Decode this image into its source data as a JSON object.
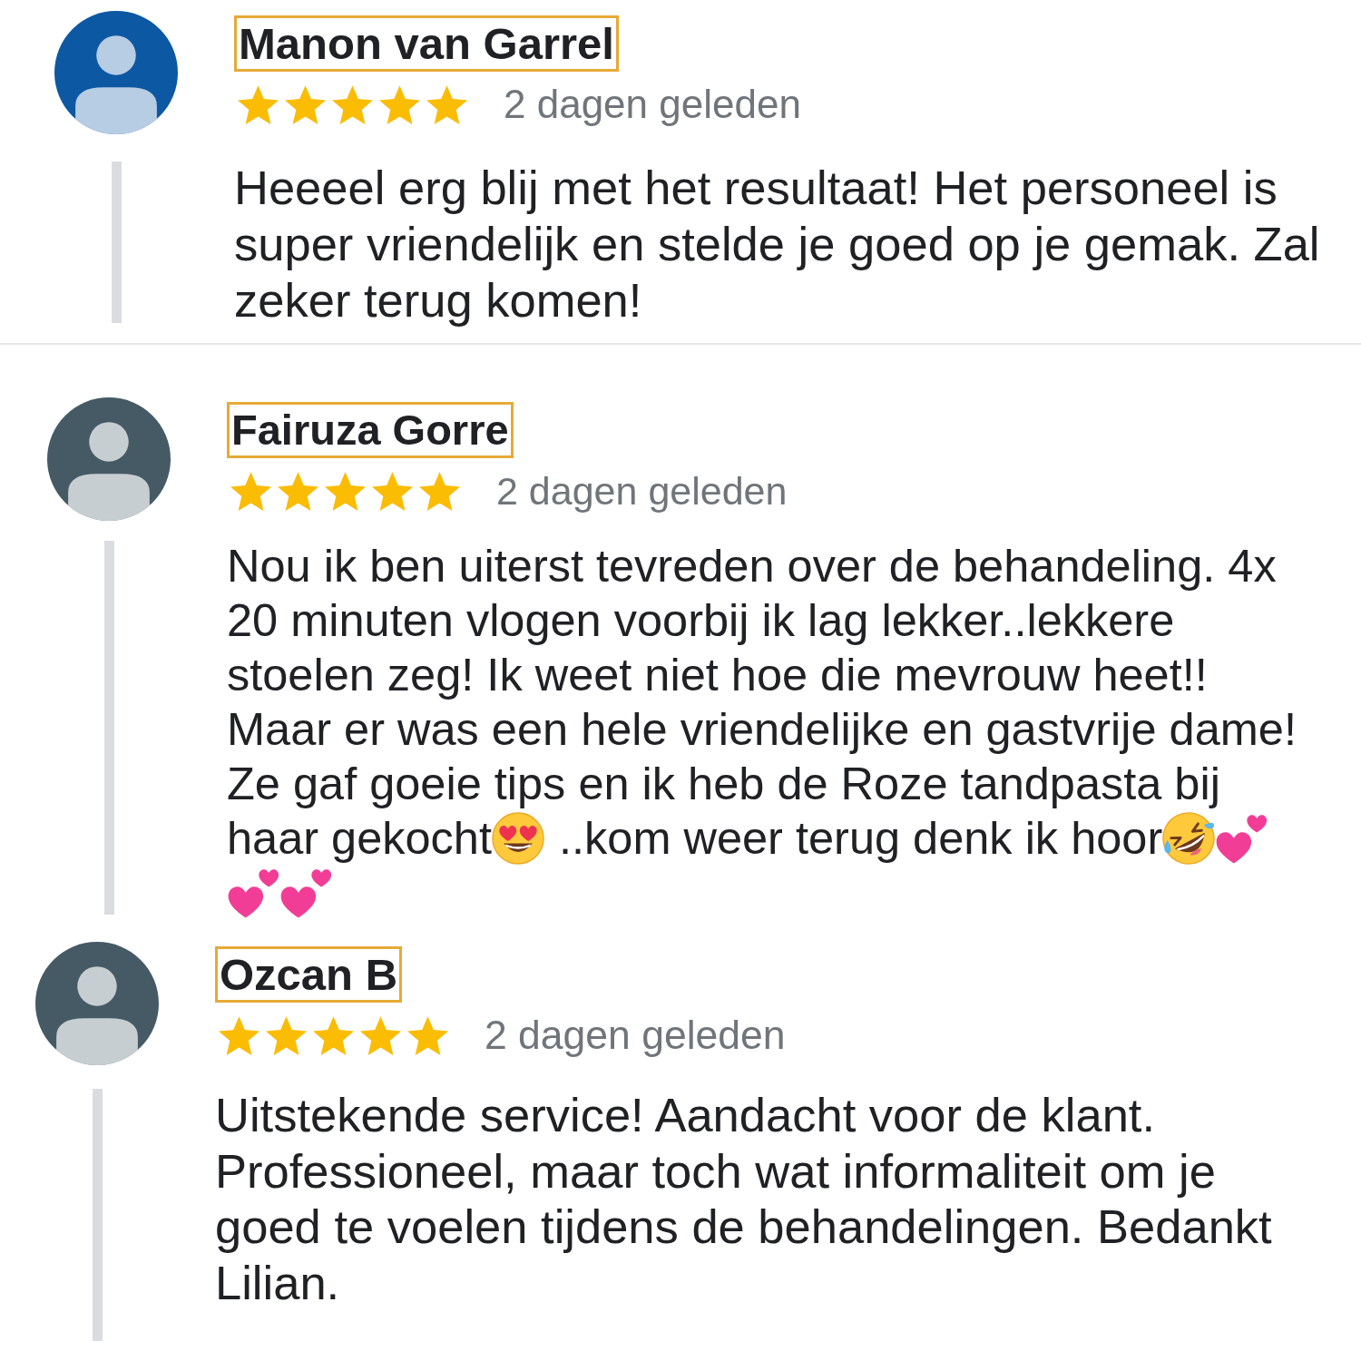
{
  "reviews": [
    {
      "avatar": {
        "color": "#0d58a3"
      },
      "author": {
        "name": "Manon van Garrel",
        "highlighted": true
      },
      "stars": 5,
      "time": "2 dagen geleden",
      "body": [
        {
          "kind": "block",
          "text": "Heeeel erg blij met het resultaat! Het personeel is super vriendelijk en stelde je goed op je gemak. Zal zeker terug komen!"
        }
      ]
    },
    {
      "avatar": {
        "color": "#455a64"
      },
      "author": {
        "name": "Fairuza Gorre",
        "highlighted": true
      },
      "stars": 5,
      "time": "2 dagen geleden",
      "body": [
        {
          "kind": "block",
          "text": "Nou ik ben uiterst tevreden over de behandeling. 4x 20 minuten vlogen voorbij ik lag lekker..lekkere stoelen zeg! Ik weet niet hoe die mevrouw heet!! Maar er was een hele vriendelijke en gastvrije dame! Ze gaf goeie tips en ik heb de Roze tandpasta bij"
        },
        {
          "kind": "text",
          "text": "haar gekocht"
        },
        {
          "kind": "hearteyes"
        },
        {
          "kind": "text",
          "text": "..kom weer terug denk ik hoor"
        },
        {
          "kind": "rofl"
        },
        {
          "kind": "hearts"
        },
        {
          "kind": "hearts"
        },
        {
          "kind": "hearts"
        }
      ]
    },
    {
      "avatar": {
        "color": "#455a64"
      },
      "author": {
        "name": "Ozcan B",
        "highlighted": true
      },
      "stars": 5,
      "time": "2 dagen geleden",
      "body": [
        {
          "kind": "block",
          "text": "Uitstekende service! Aandacht voor de klant. Professioneel, maar toch wat informaliteit om je goed te voelen tijdens de behandelingen. Bedankt Lilian."
        }
      ]
    }
  ]
}
